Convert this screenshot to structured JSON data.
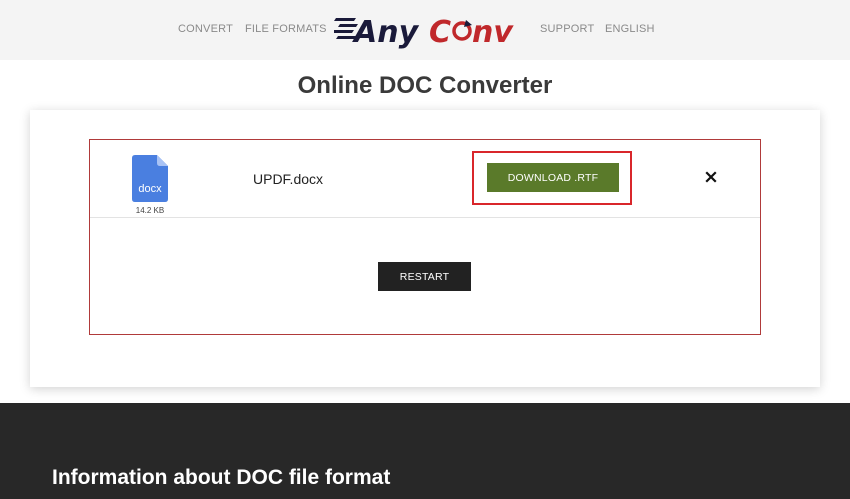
{
  "header": {
    "nav_left": [
      "CONVERT",
      "FILE FORMATS"
    ],
    "nav_right": [
      "SUPPORT",
      "ENGLISH"
    ],
    "logo_text": "AnyConv"
  },
  "page_title": "Online DOC Converter",
  "file": {
    "icon_label": "docx",
    "size": "14.2 KB",
    "name": "UPDF.docx"
  },
  "actions": {
    "download_label": "DOWNLOAD .RTF",
    "restart_label": "RESTART"
  },
  "info": {
    "heading": "Information about DOC file format"
  },
  "colors": {
    "download_green": "#5a7a2a",
    "highlight_red": "#d9262b",
    "panel_border": "#b03a3a",
    "dark_section": "#282828",
    "file_icon_blue": "#4a7fe0"
  }
}
